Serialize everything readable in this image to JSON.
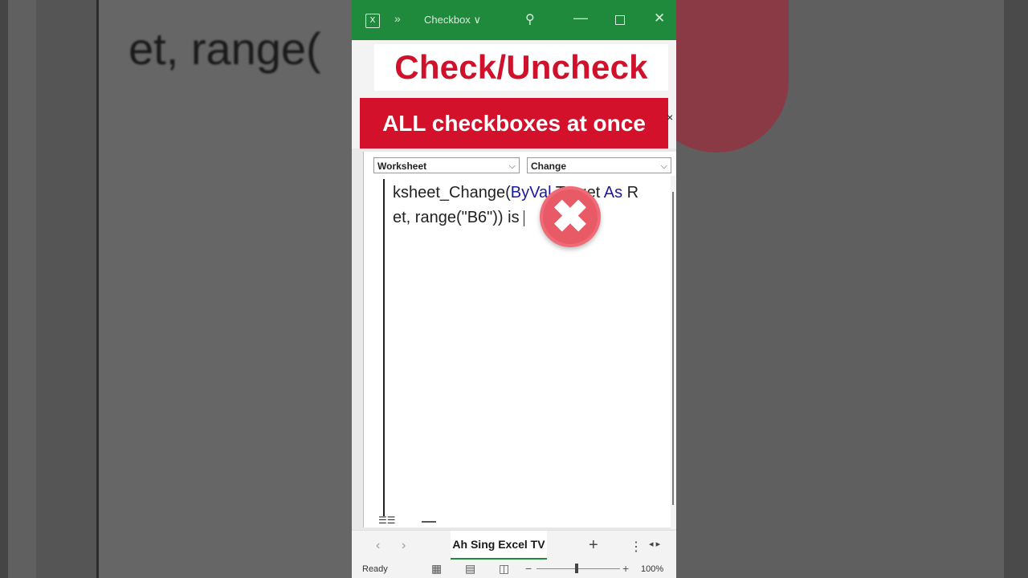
{
  "window": {
    "title": "Checkbox",
    "title_chevron": "∨",
    "more": "»",
    "excel_icon": "X",
    "search_icon": "⚲",
    "minimize_icon": "—",
    "close_icon": "✕"
  },
  "overlay": {
    "headline": "Check/Uncheck",
    "subheadline": "ALL checkboxes at once",
    "close_x": "×",
    "badge_glyph": "✖",
    "badge_color": "#e85a66",
    "headline_color": "#d0112b"
  },
  "editor": {
    "object_dropdown": "Worksheet",
    "procedure_dropdown": "Change",
    "code_lines": [
      {
        "pre": "ksheet_Change(",
        "kw": "ByVal",
        "mid": " Target ",
        "kw2": "As",
        "post": " R"
      },
      {
        "pre": "et, range(\"B6\")) is ",
        "kw": "",
        "mid": "",
        "kw2": "",
        "post": ""
      }
    ]
  },
  "sheets": {
    "active_tab": "Ah Sing Excel TV",
    "prev": "‹",
    "next": "›",
    "add": "+",
    "menu": "⋮",
    "arrows": "◂ ▸"
  },
  "status": {
    "ready": "Ready",
    "zoom": "100%",
    "zoom_minus": "−",
    "zoom_plus": "+"
  },
  "background": {
    "blurred_text": "et, range("
  },
  "colors": {
    "titlebar": "#1f8a3c",
    "banner_red": "#d4112b"
  }
}
